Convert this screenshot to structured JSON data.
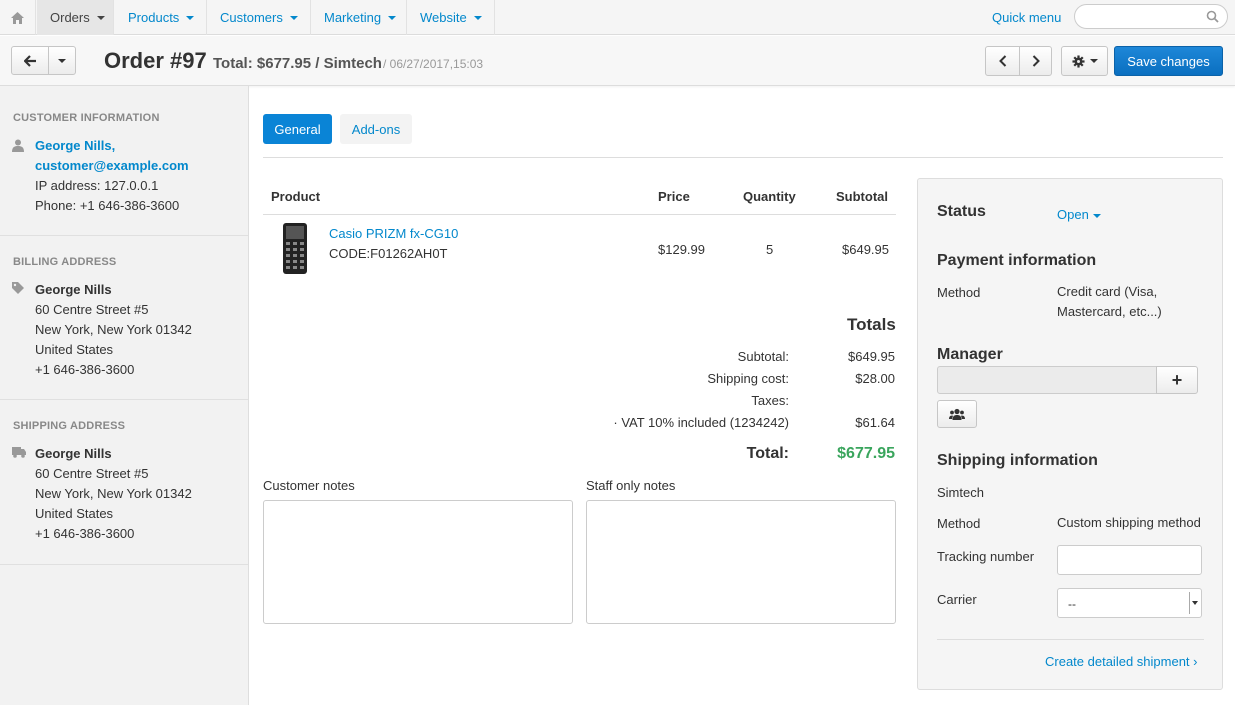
{
  "nav": {
    "items": [
      {
        "label": "Orders"
      },
      {
        "label": "Products"
      },
      {
        "label": "Customers"
      },
      {
        "label": "Marketing"
      },
      {
        "label": "Website"
      }
    ],
    "quick_menu": "Quick menu",
    "search_placeholder": ""
  },
  "header": {
    "title": "Order #97",
    "total": "Total: $677.95 / Simtech",
    "date": "/ 06/27/2017,15:03",
    "save_label": "Save changes"
  },
  "sidebar": {
    "customer": {
      "title": "CUSTOMER INFORMATION",
      "name": "George Nills,",
      "email": "customer@example.com",
      "ip": "IP address: 127.0.0.1",
      "phone": "Phone: +1 646-386-3600"
    },
    "billing": {
      "title": "BILLING ADDRESS",
      "name": "George Nills",
      "street": "60 Centre Street #5",
      "city": "New York, New York 01342",
      "country": "United States",
      "phone": "+1 646-386-3600"
    },
    "shipping": {
      "title": "SHIPPING ADDRESS",
      "name": "George Nills",
      "street": "60 Centre Street #5",
      "city": "New York, New York 01342",
      "country": "United States",
      "phone": "+1 646-386-3600"
    }
  },
  "tabs": [
    {
      "label": "General"
    },
    {
      "label": "Add-ons"
    }
  ],
  "products": {
    "columns": [
      "Product",
      "Price",
      "Quantity",
      "Subtotal"
    ],
    "rows": [
      {
        "name": "Casio PRIZM fx-CG10",
        "code": "CODE:F01262AH0T",
        "price": "$129.99",
        "quantity": "5",
        "subtotal": "$649.95"
      }
    ]
  },
  "totals": {
    "title": "Totals",
    "subtotal_label": "Subtotal:",
    "subtotal": "$649.95",
    "shipping_label": "Shipping cost:",
    "shipping": "$28.00",
    "taxes_label": "Taxes:",
    "vat_label": "· VAT 10% included (1234242)",
    "vat": "$61.64",
    "total_label": "Total:",
    "total": "$677.95"
  },
  "notes": {
    "customer_label": "Customer notes",
    "staff_label": "Staff only notes"
  },
  "panel": {
    "status_label": "Status",
    "status_value": "Open",
    "payment_title": "Payment information",
    "method_label": "Method",
    "payment_method": "Credit card (Visa, Mastercard, etc...)",
    "manager_title": "Manager",
    "shipping_title": "Shipping information",
    "shipping_company": "Simtech",
    "shipping_method_label": "Method",
    "shipping_method": "Custom shipping method",
    "tracking_label": "Tracking number",
    "carrier_label": "Carrier",
    "carrier_value": "--",
    "create_shipment": "Create detailed shipment ›"
  },
  "colors": {
    "link": "#0388cc",
    "primary_button": "#0a84d6",
    "total_green": "#3aa55d"
  }
}
